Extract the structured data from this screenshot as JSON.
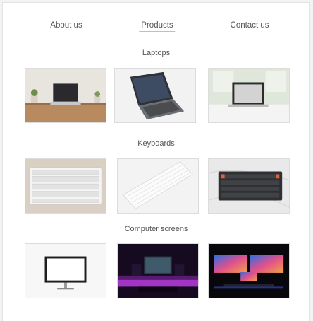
{
  "nav": {
    "items": [
      {
        "label": "About us"
      },
      {
        "label": "Products"
      },
      {
        "label": "Contact us"
      }
    ],
    "active_label": "Products"
  },
  "sections": [
    {
      "title": "Laptops",
      "images": [
        "laptop-on-wooden-desk-photo",
        "laptop-angled-silver-photo",
        "laptop-on-desk-by-window-photo"
      ]
    },
    {
      "title": "Keyboards",
      "images": [
        "white-keyboard-photo",
        "white-keyboard-angled-photo",
        "dark-keyboard-on-marble-photo"
      ]
    },
    {
      "title": "Computer screens",
      "images": [
        "white-monitor-photo",
        "gaming-setup-purple-photo",
        "dual-monitor-colorful-photo"
      ]
    }
  ],
  "colors": {
    "text": "#555555",
    "border": "#dcdcdc",
    "accent_purple": "#b13bd6"
  }
}
